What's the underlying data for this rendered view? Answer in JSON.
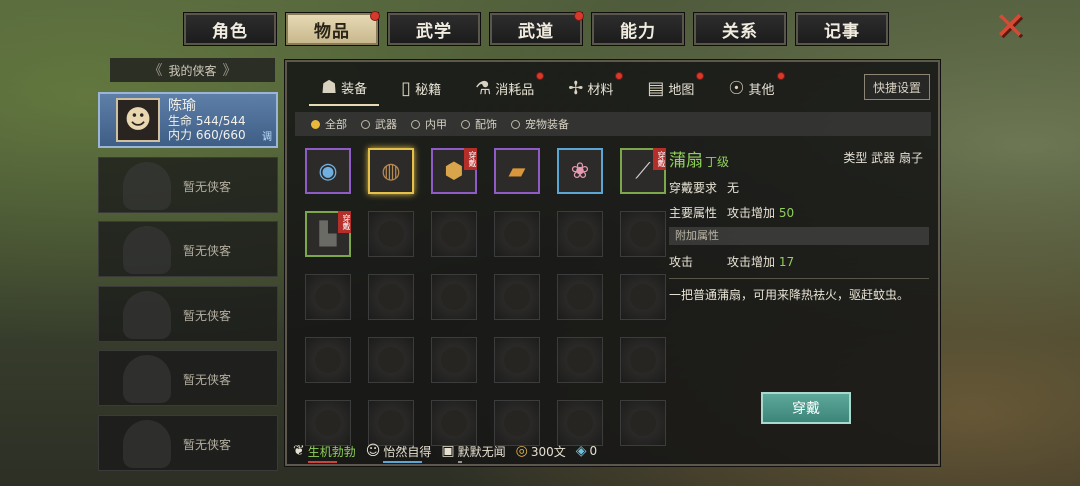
{
  "top_tabs": [
    {
      "label": "角色",
      "badge": false,
      "active": false
    },
    {
      "label": "物品",
      "badge": true,
      "active": true
    },
    {
      "label": "武学",
      "badge": false,
      "active": false
    },
    {
      "label": "武道",
      "badge": true,
      "active": false
    },
    {
      "label": "能力",
      "badge": false,
      "active": false
    },
    {
      "label": "关系",
      "badge": false,
      "active": false
    },
    {
      "label": "记事",
      "badge": false,
      "active": false
    }
  ],
  "left_panel": {
    "header": "我的侠客",
    "active": {
      "name": "陈瑜",
      "hp_label": "生命",
      "hp": "544/544",
      "mp_label": "内力",
      "mp": "660/660",
      "tune_label": "调"
    },
    "empty_label": "暂无侠客",
    "empty_count": 5
  },
  "sub_tabs": [
    {
      "label": "装备",
      "icon": "armor-icon",
      "glyph": "☗",
      "badge": false
    },
    {
      "label": "秘籍",
      "icon": "book-icon",
      "glyph": "▯",
      "badge": false
    },
    {
      "label": "消耗品",
      "icon": "flask-icon",
      "glyph": "⚗",
      "badge": true
    },
    {
      "label": "材料",
      "icon": "herb-icon",
      "glyph": "✢",
      "badge": true
    },
    {
      "label": "地图",
      "icon": "map-icon",
      "glyph": "▤",
      "badge": true
    },
    {
      "label": "其他",
      "icon": "misc-icon",
      "glyph": "☉",
      "badge": true
    }
  ],
  "quick_settings": "快捷设置",
  "filters": [
    {
      "label": "全部",
      "on": true
    },
    {
      "label": "武器",
      "on": false
    },
    {
      "label": "内甲",
      "on": false
    },
    {
      "label": "配饰",
      "on": false
    },
    {
      "label": "宠物装备",
      "on": false
    }
  ],
  "grid_items": [
    {
      "name": "jade-item",
      "glyph": "◉",
      "color": "#6fb0e0",
      "border": "purple",
      "wearing": false
    },
    {
      "name": "fan-item",
      "glyph": "◍",
      "color": "#b68a52",
      "border": "gold",
      "wearing": false
    },
    {
      "name": "armor-item",
      "glyph": "⬢",
      "color": "#d8a54a",
      "border": "purple",
      "wearing": true
    },
    {
      "name": "scroll-item",
      "glyph": "▰",
      "color": "#d9963a",
      "border": "purple",
      "wearing": false
    },
    {
      "name": "flower-item",
      "glyph": "❀",
      "color": "#e79ab0",
      "border": "blue",
      "wearing": false
    },
    {
      "name": "sword-item",
      "glyph": "⟋",
      "color": "#cfcfcf",
      "border": "green",
      "wearing": true
    },
    {
      "name": "robe-item",
      "glyph": "▙",
      "color": "#6b6b66",
      "border": "green",
      "wearing": true
    }
  ],
  "wearing_tag": "穿戴",
  "total_cells": 30,
  "detail": {
    "name": "蒲扇",
    "grade": "丁级",
    "type_label": "类型",
    "type_value": "武器 扇子",
    "req_label": "穿戴要求",
    "req_value": "无",
    "main_label": "主要属性",
    "main_attr": "攻击增加",
    "main_value": "50",
    "extra_label": "附加属性",
    "extra_name": "攻击",
    "extra_attr": "攻击增加",
    "extra_value": "17",
    "description": "一把普通蒲扇，可用来降热祛火，驱赶蚊虫。"
  },
  "equip_button": "穿戴",
  "status": [
    {
      "label": "生机勃勃",
      "icon": "vitality-icon",
      "glyph": "❦",
      "color": "#8fcf5a",
      "bar_color": "#c9453a",
      "fill": 0.6
    },
    {
      "label": "怡然自得",
      "icon": "mood-icon",
      "glyph": "☺",
      "color": "#e6e0d0",
      "bar_color": "#5aa7d6",
      "fill": 0.8
    },
    {
      "label": "默默无闻",
      "icon": "fame-icon",
      "glyph": "▣",
      "color": "#e6e0d0",
      "bar_color": "#9a958a",
      "fill": 0.1
    }
  ],
  "money": "300文",
  "gems": "0"
}
